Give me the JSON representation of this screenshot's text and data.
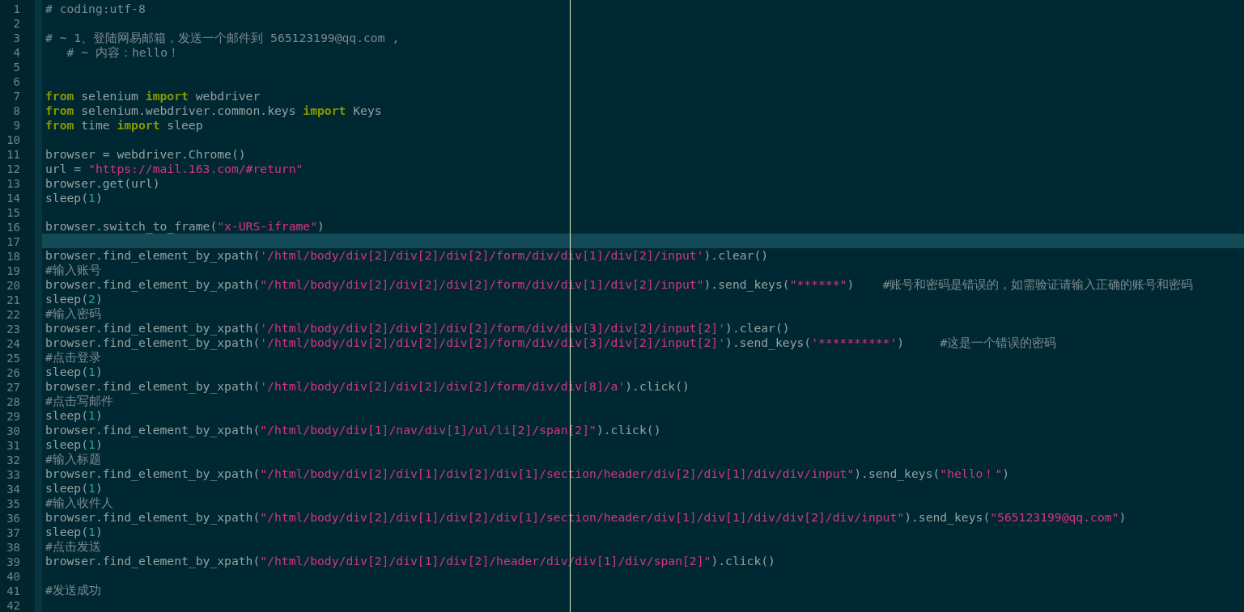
{
  "editor": {
    "lines": [
      {
        "number": "1",
        "current": false,
        "tokens": [
          {
            "kind": "comment",
            "text": "# coding:utf-8"
          }
        ]
      },
      {
        "number": "2",
        "current": false
      },
      {
        "number": "3",
        "current": false,
        "tokens": [
          {
            "kind": "comment",
            "text": "# ~ 1、登陆网易邮箱，发送一个邮件到 565123199@qq.com ,"
          }
        ]
      },
      {
        "number": "4",
        "current": false,
        "tokens": [
          {
            "kind": "comment",
            "text": "   # ~ 内容：hello！"
          }
        ]
      },
      {
        "number": "5",
        "current": false
      },
      {
        "number": "6",
        "current": false
      },
      {
        "number": "7",
        "current": false,
        "tokens": [
          {
            "kind": "keyword",
            "text": "from"
          },
          {
            "kind": "plain",
            "text": " selenium "
          },
          {
            "kind": "keyword",
            "text": "import"
          },
          {
            "kind": "plain",
            "text": " webdriver"
          }
        ]
      },
      {
        "number": "8",
        "current": false,
        "tokens": [
          {
            "kind": "keyword",
            "text": "from"
          },
          {
            "kind": "plain",
            "text": " selenium.webdriver.common.keys "
          },
          {
            "kind": "keyword",
            "text": "import"
          },
          {
            "kind": "plain",
            "text": " Keys"
          }
        ]
      },
      {
        "number": "9",
        "current": false,
        "tokens": [
          {
            "kind": "keyword",
            "text": "from"
          },
          {
            "kind": "plain",
            "text": " time "
          },
          {
            "kind": "keyword",
            "text": "import"
          },
          {
            "kind": "plain",
            "text": " sleep"
          }
        ]
      },
      {
        "number": "10",
        "current": false
      },
      {
        "number": "11",
        "current": false,
        "tokens": [
          {
            "kind": "plain",
            "text": "browser = webdriver.Chrome()"
          }
        ]
      },
      {
        "number": "12",
        "current": false,
        "tokens": [
          {
            "kind": "plain",
            "text": "url = "
          },
          {
            "kind": "string",
            "text": "\"https://mail.163.com/#return\""
          }
        ]
      },
      {
        "number": "13",
        "current": false,
        "tokens": [
          {
            "kind": "plain",
            "text": "browser.get(url)"
          }
        ]
      },
      {
        "number": "14",
        "current": false,
        "tokens": [
          {
            "kind": "plain",
            "text": "sleep("
          },
          {
            "kind": "number",
            "text": "1"
          },
          {
            "kind": "plain",
            "text": ")"
          }
        ]
      },
      {
        "number": "15",
        "current": false
      },
      {
        "number": "16",
        "current": false,
        "tokens": [
          {
            "kind": "plain",
            "text": "browser.switch_to_frame("
          },
          {
            "kind": "string",
            "text": "\"x-URS-iframe\""
          },
          {
            "kind": "plain",
            "text": ")"
          }
        ]
      },
      {
        "number": "17",
        "current": true
      },
      {
        "number": "18",
        "current": false,
        "tokens": [
          {
            "kind": "plain",
            "text": "browser.find_element_by_xpath("
          },
          {
            "kind": "string",
            "text": "'/html/body/div[2]/div[2]/div[2]/form/div/div[1]/div[2]/input'"
          },
          {
            "kind": "plain",
            "text": ").clear()"
          }
        ]
      },
      {
        "number": "19",
        "current": false,
        "tokens": [
          {
            "kind": "comment",
            "text": "#输入账号"
          }
        ]
      },
      {
        "number": "20",
        "current": false,
        "tokens": [
          {
            "kind": "plain",
            "text": "browser.find_element_by_xpath("
          },
          {
            "kind": "string",
            "text": "\"/html/body/div[2]/div[2]/div[2]/form/div/div[1]/div[2]/input\""
          },
          {
            "kind": "plain",
            "text": ").send_keys("
          },
          {
            "kind": "string",
            "text": "\"******\""
          },
          {
            "kind": "plain",
            "text": ")    "
          },
          {
            "kind": "comment",
            "text": "#账号和密码是错误的，如需验证请输入正确的账号和密码"
          }
        ]
      },
      {
        "number": "21",
        "current": false,
        "tokens": [
          {
            "kind": "plain",
            "text": "sleep("
          },
          {
            "kind": "number",
            "text": "2"
          },
          {
            "kind": "plain",
            "text": ")"
          }
        ]
      },
      {
        "number": "22",
        "current": false,
        "tokens": [
          {
            "kind": "comment",
            "text": "#输入密码"
          }
        ]
      },
      {
        "number": "23",
        "current": false,
        "tokens": [
          {
            "kind": "plain",
            "text": "browser.find_element_by_xpath("
          },
          {
            "kind": "string",
            "text": "'/html/body/div[2]/div[2]/div[2]/form/div/div[3]/div[2]/input[2]'"
          },
          {
            "kind": "plain",
            "text": ").clear()"
          }
        ]
      },
      {
        "number": "24",
        "current": false,
        "tokens": [
          {
            "kind": "plain",
            "text": "browser.find_element_by_xpath("
          },
          {
            "kind": "string",
            "text": "'/html/body/div[2]/div[2]/div[2]/form/div/div[3]/div[2]/input[2]'"
          },
          {
            "kind": "plain",
            "text": ").send_keys("
          },
          {
            "kind": "string",
            "text": "'**********'"
          },
          {
            "kind": "plain",
            "text": ")     "
          },
          {
            "kind": "comment",
            "text": "#这是一个错误的密码"
          }
        ]
      },
      {
        "number": "25",
        "current": false,
        "tokens": [
          {
            "kind": "comment",
            "text": "#点击登录"
          }
        ]
      },
      {
        "number": "26",
        "current": false,
        "tokens": [
          {
            "kind": "plain",
            "text": "sleep("
          },
          {
            "kind": "number",
            "text": "1"
          },
          {
            "kind": "plain",
            "text": ")"
          }
        ]
      },
      {
        "number": "27",
        "current": false,
        "tokens": [
          {
            "kind": "plain",
            "text": "browser.find_element_by_xpath("
          },
          {
            "kind": "string",
            "text": "'/html/body/div[2]/div[2]/div[2]/form/div/div[8]/a'"
          },
          {
            "kind": "plain",
            "text": ").click()"
          }
        ]
      },
      {
        "number": "28",
        "current": false,
        "tokens": [
          {
            "kind": "comment",
            "text": "#点击写邮件"
          }
        ]
      },
      {
        "number": "29",
        "current": false,
        "tokens": [
          {
            "kind": "plain",
            "text": "sleep("
          },
          {
            "kind": "number",
            "text": "1"
          },
          {
            "kind": "plain",
            "text": ")"
          }
        ]
      },
      {
        "number": "30",
        "current": false,
        "tokens": [
          {
            "kind": "plain",
            "text": "browser.find_element_by_xpath("
          },
          {
            "kind": "string",
            "text": "\"/html/body/div[1]/nav/div[1]/ul/li[2]/span[2]\""
          },
          {
            "kind": "plain",
            "text": ").click()"
          }
        ]
      },
      {
        "number": "31",
        "current": false,
        "tokens": [
          {
            "kind": "plain",
            "text": "sleep("
          },
          {
            "kind": "number",
            "text": "1"
          },
          {
            "kind": "plain",
            "text": ")"
          }
        ]
      },
      {
        "number": "32",
        "current": false,
        "tokens": [
          {
            "kind": "comment",
            "text": "#输入标题"
          }
        ]
      },
      {
        "number": "33",
        "current": false,
        "tokens": [
          {
            "kind": "plain",
            "text": "browser.find_element_by_xpath("
          },
          {
            "kind": "string",
            "text": "\"/html/body/div[2]/div[1]/div[2]/div[1]/section/header/div[2]/div[1]/div/div/input\""
          },
          {
            "kind": "plain",
            "text": ").send_keys("
          },
          {
            "kind": "string",
            "text": "\"hello！\""
          },
          {
            "kind": "plain",
            "text": ")"
          }
        ]
      },
      {
        "number": "34",
        "current": false,
        "tokens": [
          {
            "kind": "plain",
            "text": "sleep("
          },
          {
            "kind": "number",
            "text": "1"
          },
          {
            "kind": "plain",
            "text": ")"
          }
        ]
      },
      {
        "number": "35",
        "current": false,
        "tokens": [
          {
            "kind": "comment",
            "text": "#输入收件人"
          }
        ]
      },
      {
        "number": "36",
        "current": false,
        "tokens": [
          {
            "kind": "plain",
            "text": "browser.find_element_by_xpath("
          },
          {
            "kind": "string",
            "text": "\"/html/body/div[2]/div[1]/div[2]/div[1]/section/header/div[1]/div[1]/div/div[2]/div/input\""
          },
          {
            "kind": "plain",
            "text": ").send_keys("
          },
          {
            "kind": "string",
            "text": "\"565123199@qq.com\""
          },
          {
            "kind": "plain",
            "text": ")"
          }
        ]
      },
      {
        "number": "37",
        "current": false,
        "tokens": [
          {
            "kind": "plain",
            "text": "sleep("
          },
          {
            "kind": "number",
            "text": "1"
          },
          {
            "kind": "plain",
            "text": ")"
          }
        ]
      },
      {
        "number": "38",
        "current": false,
        "tokens": [
          {
            "kind": "comment",
            "text": "#点击发送"
          }
        ]
      },
      {
        "number": "39",
        "current": false,
        "tokens": [
          {
            "kind": "plain",
            "text": "browser.find_element_by_xpath("
          },
          {
            "kind": "string",
            "text": "\"/html/body/div[2]/div[1]/div[2]/header/div/div[1]/div/span[2]\""
          },
          {
            "kind": "plain",
            "text": ").click()"
          }
        ]
      },
      {
        "number": "40",
        "current": false
      },
      {
        "number": "41",
        "current": false,
        "tokens": [
          {
            "kind": "comment",
            "text": "#发送成功"
          }
        ]
      },
      {
        "number": "42",
        "current": false
      }
    ]
  }
}
